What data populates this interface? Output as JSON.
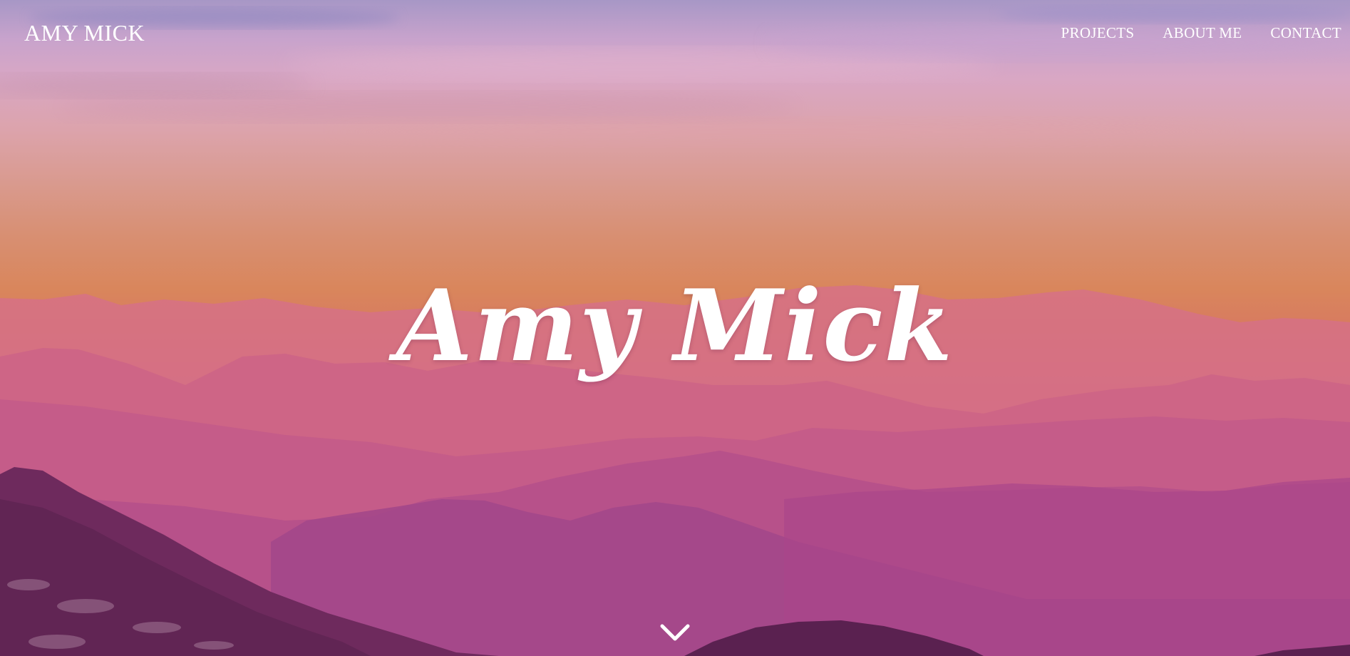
{
  "header": {
    "brand": "AMY MICK",
    "nav": [
      {
        "label": "PROJECTS"
      },
      {
        "label": "ABOUT ME"
      },
      {
        "label": "CONTACT"
      }
    ]
  },
  "hero": {
    "title": "Amy Mick",
    "scroll_icon": "chevron-down-icon"
  },
  "colors": {
    "text": "#ffffff",
    "sky_top": "#a797c6",
    "sky_sunset": "#d9865c",
    "mountain_far": "#d26a88",
    "mountain_mid": "#b8558e",
    "mountain_near": "#7a2f66"
  }
}
